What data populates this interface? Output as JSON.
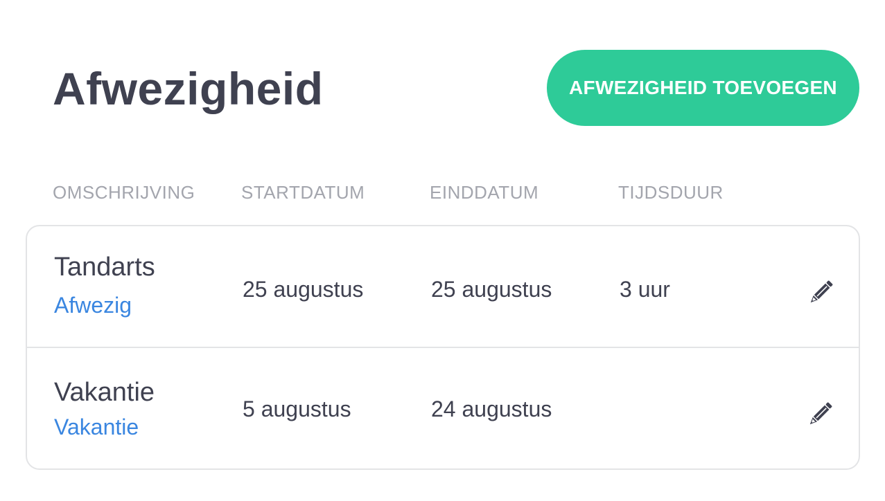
{
  "header": {
    "title": "Afwezigheid",
    "add_button_label": "AFWEZIGHEID TOEVOEGEN",
    "accent_color": "#2ecb98"
  },
  "table": {
    "columns": [
      "OMSCHRIJVING",
      "STARTDATUM",
      "EINDDATUM",
      "TIJDSDUUR"
    ],
    "rows": [
      {
        "description": "Tandarts",
        "type": "Afwezig",
        "start": "25 augustus",
        "end": "25 augustus",
        "duration": "3 uur",
        "action_icon": "pencil-icon"
      },
      {
        "description": "Vakantie",
        "type": "Vakantie",
        "start": "5 augustus",
        "end": "24 augustus",
        "duration": "",
        "action_icon": "pencil-icon"
      }
    ]
  },
  "colors": {
    "text": "#3f4150",
    "muted": "#a3a5ad",
    "link": "#3a86e0",
    "border": "#e3e4e6"
  }
}
